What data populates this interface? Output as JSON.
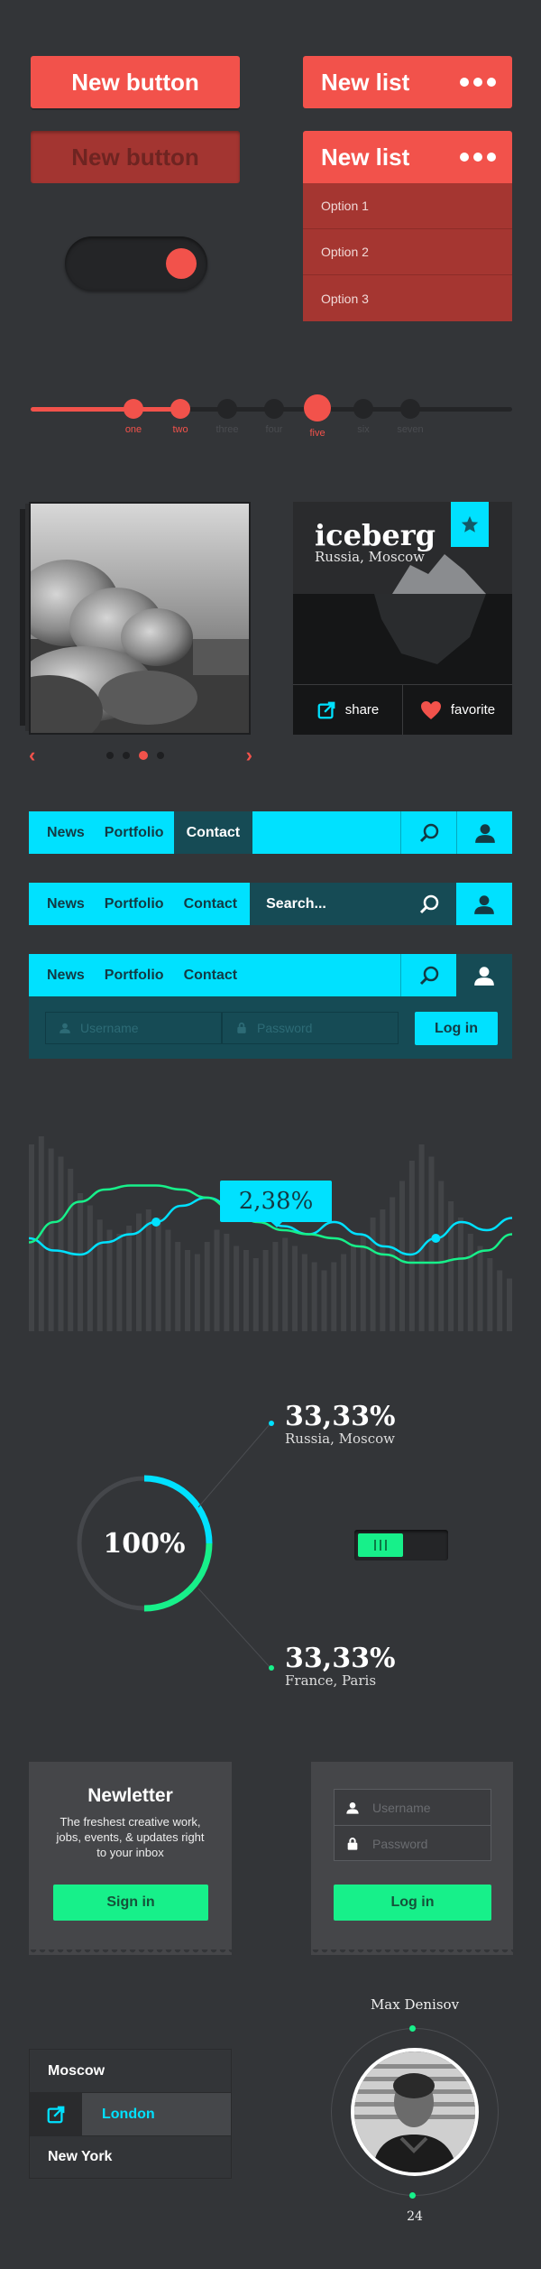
{
  "buttons": {
    "new_button": "New button",
    "new_button_pressed": "New button",
    "new_list": "New list",
    "new_list_open": "New list",
    "list_options": [
      "Option 1",
      "Option 2",
      "Option 3"
    ]
  },
  "toggle": {
    "state": "on"
  },
  "slider": {
    "labels": [
      "one",
      "two",
      "three",
      "four",
      "five",
      "six",
      "seven"
    ],
    "active_index": 4,
    "accent": "#f2524b"
  },
  "gallery": {
    "active_slide": 2,
    "total_slides": 4
  },
  "iceberg": {
    "title": "iceberg",
    "subtitle": "Russia, Moscow",
    "share_label": "share",
    "favorite_label": "favorite"
  },
  "nav1": {
    "items": [
      "News",
      "Portfolio",
      "Contact"
    ],
    "active": "Contact"
  },
  "nav2": {
    "items": [
      "News",
      "Portfolio",
      "Contact"
    ],
    "search_placeholder": "Search..."
  },
  "nav3": {
    "items": [
      "News",
      "Portfolio",
      "Contact"
    ],
    "username_placeholder": "Username",
    "password_placeholder": "Password",
    "login_label": "Log in"
  },
  "chart_data": {
    "type": "line",
    "title": "",
    "callout": "2,38%",
    "bars": [
      92,
      96,
      90,
      86,
      80,
      68,
      62,
      55,
      50,
      48,
      52,
      58,
      60,
      56,
      50,
      44,
      40,
      38,
      44,
      50,
      48,
      42,
      40,
      36,
      40,
      44,
      46,
      42,
      38,
      34,
      30,
      34,
      38,
      42,
      48,
      56,
      60,
      66,
      74,
      84,
      92,
      86,
      74,
      64,
      56,
      48,
      42,
      36,
      30,
      26
    ],
    "series": [
      {
        "color": "#00e1ff",
        "values": [
          28,
          22,
          20,
          26,
          30,
          36,
          44,
          48,
          44,
          40,
          34,
          30,
          36,
          30,
          24,
          20,
          28,
          36,
          32,
          38
        ]
      },
      {
        "color": "#17f08a",
        "values": [
          26,
          36,
          46,
          52,
          54,
          54,
          52,
          48,
          42,
          36,
          32,
          30,
          28,
          24,
          20,
          16,
          16,
          18,
          22,
          30
        ]
      }
    ],
    "ylim": [
      0,
      100
    ]
  },
  "donut": {
    "center_label": "100%",
    "percent_cyan": 25,
    "percent_green": 25,
    "stat1_value": "33,33%",
    "stat1_label": "Russia, Moscow",
    "stat2_value": "33,33%",
    "stat2_label": "France, Paris"
  },
  "newsletter": {
    "title": "Newletter",
    "body": "The freshest creative work, jobs, events, & updates right to your inbox",
    "signin_label": "Sign in"
  },
  "login": {
    "username_placeholder": "Username",
    "password_placeholder": "Password",
    "login_label": "Log in"
  },
  "cities": {
    "items": [
      "Moscow",
      "London",
      "New York"
    ],
    "active": "London"
  },
  "profile": {
    "name": "Max Denisov",
    "count": "24"
  },
  "colors": {
    "red": "#f2524b",
    "cyan": "#00e1ff",
    "green": "#17f08a",
    "bg": "#333538"
  }
}
